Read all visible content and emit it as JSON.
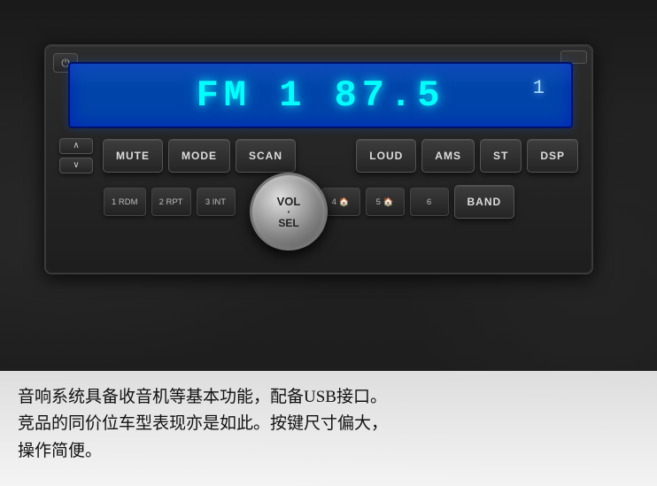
{
  "display": {
    "line1": "FM 1  87.5",
    "indicator": "1",
    "mode": "FM",
    "channel": "1",
    "frequency": "87.5"
  },
  "buttons": {
    "power_label": "⏻",
    "mute_label": "MUTE",
    "mode_label": "MODE",
    "scan_label": "SCAN",
    "loud_label": "LOUD",
    "ams_label": "AMS",
    "st_label": "ST",
    "dsp_label": "DSP",
    "band_label": "BAND",
    "vol_label": "VOL",
    "sel_label": "SEL",
    "dot_label": "•",
    "preset1_label": "1 RDM",
    "preset2_label": "2 RPT",
    "preset3_label": "3 INT",
    "preset4_label": "4 🏠",
    "preset5_label": "5 🏠",
    "preset6_label": "6",
    "arrow_up": "∧",
    "arrow_down": "∨"
  },
  "caption": {
    "line1": "音响系统具备收音机等基本功能，配备USB接口。",
    "line2": "竞品的同价位车型表现亦是如此。按键尺寸偏大，",
    "line3": "操作简便。"
  },
  "usb": {
    "label": "USB"
  }
}
